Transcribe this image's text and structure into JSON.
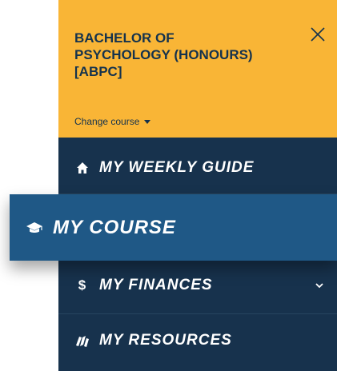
{
  "course": {
    "title": "BACHELOR OF PSYCHOLOGY (HONOURS) [ABPC]",
    "change_label": "Change course"
  },
  "nav": {
    "items": [
      {
        "label": "MY WEEKLY GUIDE",
        "icon": "home-icon"
      },
      {
        "label": "MY COURSE",
        "icon": "graduation-cap-icon",
        "active": true
      },
      {
        "label": "MY FINANCES",
        "icon": "dollar-icon",
        "expandable": true
      },
      {
        "label": "MY RESOURCES",
        "icon": "books-icon"
      }
    ]
  },
  "colors": {
    "header_bg": "#f9b536",
    "panel_bg": "#17324d",
    "active_bg": "#1f5886",
    "text_dark": "#14324d",
    "text_light": "#ffffff"
  }
}
